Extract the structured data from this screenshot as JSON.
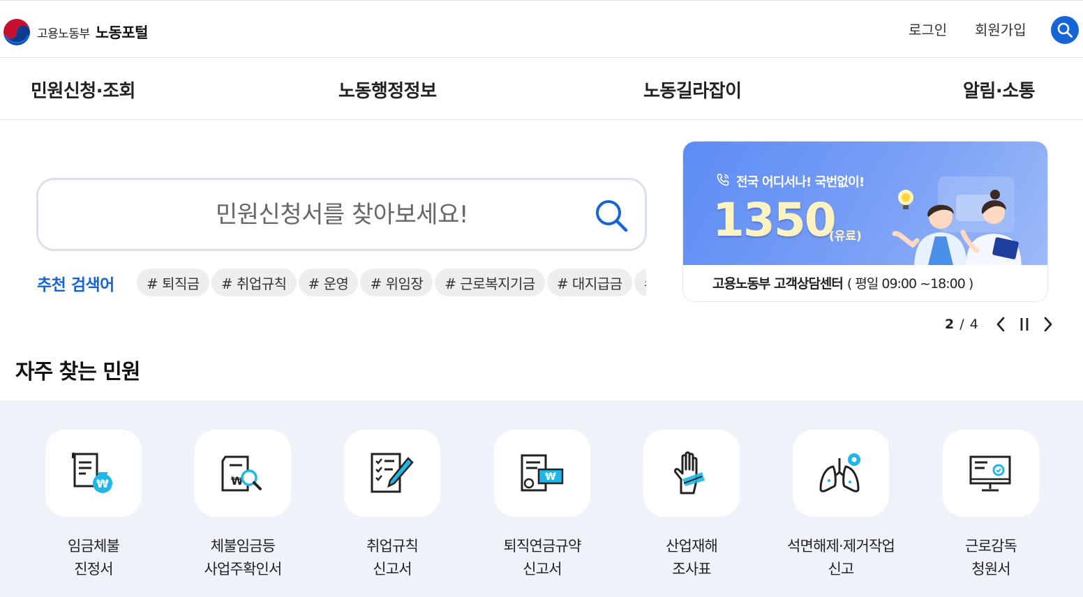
{
  "header": {
    "ministry_name": "고용노동부",
    "portal_name": "노동포털",
    "login_label": "로그인",
    "signup_label": "회원가입"
  },
  "gnb": {
    "items": [
      "민원신청·조회",
      "노동행정정보",
      "노동길라잡이",
      "알림·소통"
    ]
  },
  "search": {
    "placeholder": "민원신청서를 찾아보세요!",
    "recommend_label": "추천 검색어",
    "keywords": [
      "# 퇴직금",
      "# 취업규칙",
      "# 운영",
      "# 위임장",
      "# 근로복지기금",
      "# 대지급금",
      "# 임금체불"
    ]
  },
  "banner": {
    "tagline": "전국 어디서나! 국번없이!",
    "number": "1350",
    "paid_note": "(유료)",
    "center_name": "고용노동부 고객상담센터",
    "hours": "( 평일 09:00 ~18:00 )",
    "current_slide": "2",
    "total_slides": "4"
  },
  "frequent": {
    "title": "자주 찾는 민원",
    "items": [
      {
        "line1": "임금체불",
        "line2": "진정서",
        "icon": "wage-document-icon"
      },
      {
        "line1": "체불임금등",
        "line2": "사업주확인서",
        "icon": "document-search-icon"
      },
      {
        "line1": "취업규칙",
        "line2": "신고서",
        "icon": "checklist-pencil-icon"
      },
      {
        "line1": "퇴직연금규약",
        "line2": "신고서",
        "icon": "pension-certificate-icon"
      },
      {
        "line1": "산업재해",
        "line2": "조사표",
        "icon": "injured-hand-icon"
      },
      {
        "line1": "석면해제·제거작업",
        "line2": "신고",
        "icon": "lungs-icon"
      },
      {
        "line1": "근로감독",
        "line2": "청원서",
        "icon": "monitor-check-icon"
      }
    ]
  },
  "colors": {
    "brand_blue": "#1565d8",
    "banner_blue": "#6b95f5",
    "services_bg": "#eff2f9",
    "icon_accent": "#1fb6e8"
  }
}
